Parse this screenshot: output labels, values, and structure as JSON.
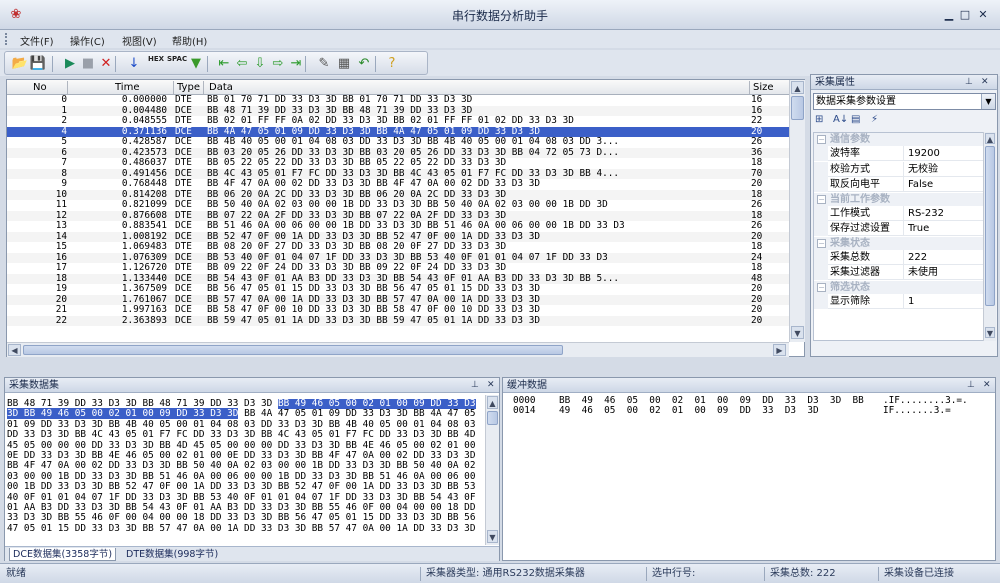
{
  "window": {
    "title": "串行数据分析助手",
    "app_icon": "app-logo-icon",
    "minimize": "▁",
    "maximize": "□",
    "close": "✕"
  },
  "menu": {
    "items": [
      "文件(F)",
      "操作(C)",
      "视图(V)",
      "帮助(H)"
    ]
  },
  "toolbar": {
    "buttons": [
      {
        "name": "open-folder-icon",
        "glyph": "📂",
        "color": "#c8962a"
      },
      {
        "name": "save-icon",
        "glyph": "💾",
        "color": "#2a4a8a"
      },
      {
        "name": "play-icon",
        "glyph": "▶",
        "color": "#1a8a5a"
      },
      {
        "name": "stop-icon",
        "glyph": "■",
        "color": "#9aa0aa"
      },
      {
        "name": "delete-icon",
        "glyph": "✕",
        "color": "#d02020"
      },
      {
        "name": "download-arrow-icon",
        "glyph": "↓",
        "color": "#1a4ac8"
      },
      {
        "name": "hex-icon",
        "glyph": "HEX",
        "color": "#222222"
      },
      {
        "name": "spac-icon",
        "glyph": "SPAC",
        "color": "#222222"
      },
      {
        "name": "filter-icon",
        "glyph": "▼",
        "color": "#3a9a2a"
      },
      {
        "name": "first-icon",
        "glyph": "⇤",
        "color": "#2a9a2a"
      },
      {
        "name": "back-icon",
        "glyph": "⇦",
        "color": "#2a9a2a"
      },
      {
        "name": "down-icon",
        "glyph": "⇩",
        "color": "#2a9a2a"
      },
      {
        "name": "forward-icon",
        "glyph": "⇨",
        "color": "#2a9a2a"
      },
      {
        "name": "last-icon",
        "glyph": "⇥",
        "color": "#2a9a2a"
      },
      {
        "name": "brush-icon",
        "glyph": "✎",
        "color": "#555555"
      },
      {
        "name": "grid-icon",
        "glyph": "▦",
        "color": "#555555"
      },
      {
        "name": "undo-icon",
        "glyph": "↶",
        "color": "#2a8a2a"
      },
      {
        "name": "help-icon",
        "glyph": "?",
        "color": "#d0a020"
      }
    ]
  },
  "packet_table": {
    "headers": {
      "no": "No",
      "time": "Time",
      "type": "Type",
      "data": "Data",
      "size": "Size"
    },
    "selected_index": 4,
    "rows": [
      {
        "no": "0",
        "time": "0.000000",
        "type": "DTE",
        "data": "BB 01 70 71 DD 33 D3 3D BB 01 70 71 DD 33 D3 3D",
        "size": "16"
      },
      {
        "no": "1",
        "time": "0.004480",
        "type": "DCE",
        "data": "BB 48 71 39 DD 33 D3 3D BB 48 71 39 DD 33 D3 3D",
        "size": "16"
      },
      {
        "no": "2",
        "time": "0.048555",
        "type": "DTE",
        "data": "BB 02 01 FF FF 0A 02 DD 33 D3 3D BB 02 01 FF FF 01 02 DD 33 D3 3D",
        "size": "22"
      },
      {
        "no": "4",
        "time": "0.371136",
        "type": "DCE",
        "data": "BB 4A 47 05 01 09 DD 33 D3 3D BB 4A 47 05 01 09 DD 33 D3 3D",
        "size": "20"
      },
      {
        "no": "5",
        "time": "0.428587",
        "type": "DCE",
        "data": "BB 4B 40 05 00 01 04 08 03 DD 33 D3 3D BB 4B 40 05 00 01 04 08 03 DD 3...",
        "size": "26"
      },
      {
        "no": "6",
        "time": "0.423573",
        "type": "DCE",
        "data": "BB 03 20 05 26 DD 33 D3 3D BB 03 20 05 26 DD 33 D3 3D BB 04 72 05 73 D...",
        "size": "36"
      },
      {
        "no": "7",
        "time": "0.486037",
        "type": "DTE",
        "data": "BB 05 22 05 22 DD 33 D3 3D BB 05 22 05 22 DD 33 D3 3D",
        "size": "18"
      },
      {
        "no": "8",
        "time": "0.491456",
        "type": "DCE",
        "data": "BB 4C 43 05 01 F7 FC DD 33 D3 3D BB 4C 43 05 01 F7 FC DD 33 D3 3D BB 4...",
        "size": "70"
      },
      {
        "no": "9",
        "time": "0.768448",
        "type": "DTE",
        "data": "BB 4F 47 0A 00 02 DD 33 D3 3D BB 4F 47 0A 00 02 DD 33 D3 3D",
        "size": "20"
      },
      {
        "no": "10",
        "time": "0.814208",
        "type": "DTE",
        "data": "BB 06 20 0A 2C DD 33 D3 3D BB 06 20 0A 2C DD 33 D3 3D",
        "size": "18"
      },
      {
        "no": "11",
        "time": "0.821099",
        "type": "DCE",
        "data": "BB 50 40 0A 02 03 00 00 1B DD 33 D3 3D BB 50 40 0A 02 03 00 00 1B DD 3D",
        "size": "26"
      },
      {
        "no": "12",
        "time": "0.876608",
        "type": "DTE",
        "data": "BB 07 22 0A 2F DD 33 D3 3D BB 07 22 0A 2F DD 33 D3 3D",
        "size": "18"
      },
      {
        "no": "13",
        "time": "0.883541",
        "type": "DCE",
        "data": "BB 51 46 0A 00 06 00 00 1B DD 33 D3 3D BB 51 46 0A 00 06 00 00 1B DD 33 D3",
        "size": "26"
      },
      {
        "no": "14",
        "time": "1.008192",
        "type": "DCE",
        "data": "BB 52 47 0F 00 1A DD 33 D3 3D BB 52 47 0F 00 1A DD 33 D3 3D",
        "size": "20"
      },
      {
        "no": "15",
        "time": "1.069483",
        "type": "DTE",
        "data": "BB 08 20 0F 27 DD 33 D3 3D BB 08 20 0F 27 DD 33 D3 3D",
        "size": "18"
      },
      {
        "no": "16",
        "time": "1.076309",
        "type": "DCE",
        "data": "BB 53 40 0F 01 04 07 1F DD 33 D3 3D BB 53 40 0F 01 01 04 07 1F DD 33 D3",
        "size": "24"
      },
      {
        "no": "17",
        "time": "1.126720",
        "type": "DTE",
        "data": "BB 09 22 0F 24 DD 33 D3 3D BB 09 22 0F 24 DD 33 D3 3D",
        "size": "18"
      },
      {
        "no": "18",
        "time": "1.133440",
        "type": "DCE",
        "data": "BB 54 43 0F 01 AA B3 DD 33 D3 3D BB 54 43 0F 01 AA B3 DD 33 D3 3D BB 5...",
        "size": "48"
      },
      {
        "no": "19",
        "time": "1.367509",
        "type": "DCE",
        "data": "BB 56 47 05 01 15 DD 33 D3 3D BB 56 47 05 01 15 DD 33 D3 3D",
        "size": "20"
      },
      {
        "no": "20",
        "time": "1.761067",
        "type": "DCE",
        "data": "BB 57 47 0A 00 1A DD 33 D3 3D BB 57 47 0A 00 1A DD 33 D3 3D",
        "size": "20"
      },
      {
        "no": "21",
        "time": "1.997163",
        "type": "DCE",
        "data": "BB 58 47 0F 00 10 DD 33 D3 3D BB 58 47 0F 00 10 DD 33 D3 3D",
        "size": "20"
      },
      {
        "no": "22",
        "time": "2.363893",
        "type": "DCE",
        "data": "BB 59 47 05 01 1A DD 33 D3 3D BB 59 47 05 01 1A DD 33 D3 3D",
        "size": "20"
      }
    ]
  },
  "properties": {
    "header": "采集属性",
    "select_value": "数据采集参数设置",
    "tool_icons": [
      {
        "name": "categorized-icon",
        "glyph": "⊞"
      },
      {
        "name": "sort-az-icon",
        "glyph": "A↓"
      },
      {
        "name": "property-pages-icon",
        "glyph": "▤"
      },
      {
        "name": "events-icon",
        "glyph": "⚡"
      }
    ],
    "categories": [
      {
        "name": "通信参数",
        "items": [
          {
            "key": "波特率",
            "value": "19200"
          },
          {
            "key": "校验方式",
            "value": "无校验"
          },
          {
            "key": "取反向电平",
            "value": "False"
          }
        ]
      },
      {
        "name": "当前工作参数",
        "items": [
          {
            "key": "工作模式",
            "value": "RS-232"
          },
          {
            "key": "保存过滤设置",
            "value": "True"
          }
        ]
      },
      {
        "name": "采集状态",
        "items": [
          {
            "key": "采集总数",
            "value": "222"
          },
          {
            "key": "采集过滤器",
            "value": "未使用"
          }
        ]
      },
      {
        "name": "筛选状态",
        "items": [
          {
            "key": "显示筛除",
            "value": "1"
          }
        ]
      }
    ]
  },
  "collected": {
    "header": "采集数据集",
    "lines": [
      {
        "pre": "BB 48 71 39 DD 33 D3 3D BB 48 71 39 DD 33 D3 3D ",
        "sel": "BB 49 46 05 00 02 01 00 09 DD 33 D3",
        "post": ""
      },
      {
        "pre": "",
        "sel": "3D BB 49 46 05 00 02 01 00 09 DD 33 D3 3D",
        "post": " BB 4A 47 05 01 09 DD 33 D3 3D BB 4A 47 05"
      },
      {
        "pre": "01 09 DD 33 D3 3D BB 4B 40 05 00 01 04 08 03 DD 33 D3 3D BB 4B 40 05 00 01 04 08 03",
        "sel": "",
        "post": ""
      },
      {
        "pre": "DD 33 D3 3D BB 4C 43 05 01 F7 FC DD 33 D3 3D BB 4C 43 05 01 F7 FC DD 33 D3 3D BB 4D",
        "sel": "",
        "post": ""
      },
      {
        "pre": "45 05 00 00 00 DD 33 D3 3D BB 4D 45 05 00 00 00 DD 33 D3 3D BB 4E 46 05 00 02 01 00",
        "sel": "",
        "post": ""
      },
      {
        "pre": "0E DD 33 D3 3D BB 4E 46 05 00 02 01 00 0E DD 33 D3 3D BB 4F 47 0A 00 02 DD 33 D3 3D",
        "sel": "",
        "post": ""
      },
      {
        "pre": "BB 4F 47 0A 00 02 DD 33 D3 3D BB 50 40 0A 02 03 00 00 1B DD 33 D3 3D BB 50 40 0A 02",
        "sel": "",
        "post": ""
      },
      {
        "pre": "03 00 00 1B DD 33 D3 3D BB 51 46 0A 00 06 00 00 1B DD 33 D3 3D BB 51 46 0A 00 06 00",
        "sel": "",
        "post": ""
      },
      {
        "pre": "00 1B DD 33 D3 3D BB 52 47 0F 00 1A DD 33 D3 3D BB 52 47 0F 00 1A DD 33 D3 3D BB 53",
        "sel": "",
        "post": ""
      },
      {
        "pre": "40 0F 01 01 04 07 1F DD 33 D3 3D BB 53 40 0F 01 01 04 07 1F DD 33 D3 3D BB 54 43 0F",
        "sel": "",
        "post": ""
      },
      {
        "pre": "01 AA B3 DD 33 D3 3D BB 54 43 0F 01 AA B3 DD 33 D3 3D BB 55 46 0F 00 04 00 00 18 DD",
        "sel": "",
        "post": ""
      },
      {
        "pre": "33 D3 3D BB 55 46 0F 00 04 00 00 18 DD 33 D3 3D BB 56 47 05 01 15 DD 33 D3 3D BB 56",
        "sel": "",
        "post": ""
      },
      {
        "pre": "47 05 01 15 DD 33 D3 3D BB 57 47 0A 00 1A DD 33 D3 3D BB 57 47 0A 00 1A DD 33 D3 3D",
        "sel": "",
        "post": ""
      }
    ],
    "tabs": [
      "DCE数据集(3358字节)",
      "DTE数据集(998字节)"
    ]
  },
  "buffer": {
    "header": "缓冲数据",
    "lines": [
      {
        "addr": "0000",
        "hex": "BB  49  46  05  00  02  01  00  09  DD  33  D3  3D  BB",
        "ascii": ".IF........3.=."
      },
      {
        "addr": "0014",
        "hex": "49  46  05  00  02  01  00  09  DD  33  D3  3D",
        "ascii": "IF.......3.="
      }
    ]
  },
  "status": {
    "ready": "就绪",
    "collector_type": "采集器类型: 通用RS232数据采集器",
    "selected_row": "选中行号:",
    "total": "采集总数: 222",
    "device": "采集设备已连接"
  }
}
